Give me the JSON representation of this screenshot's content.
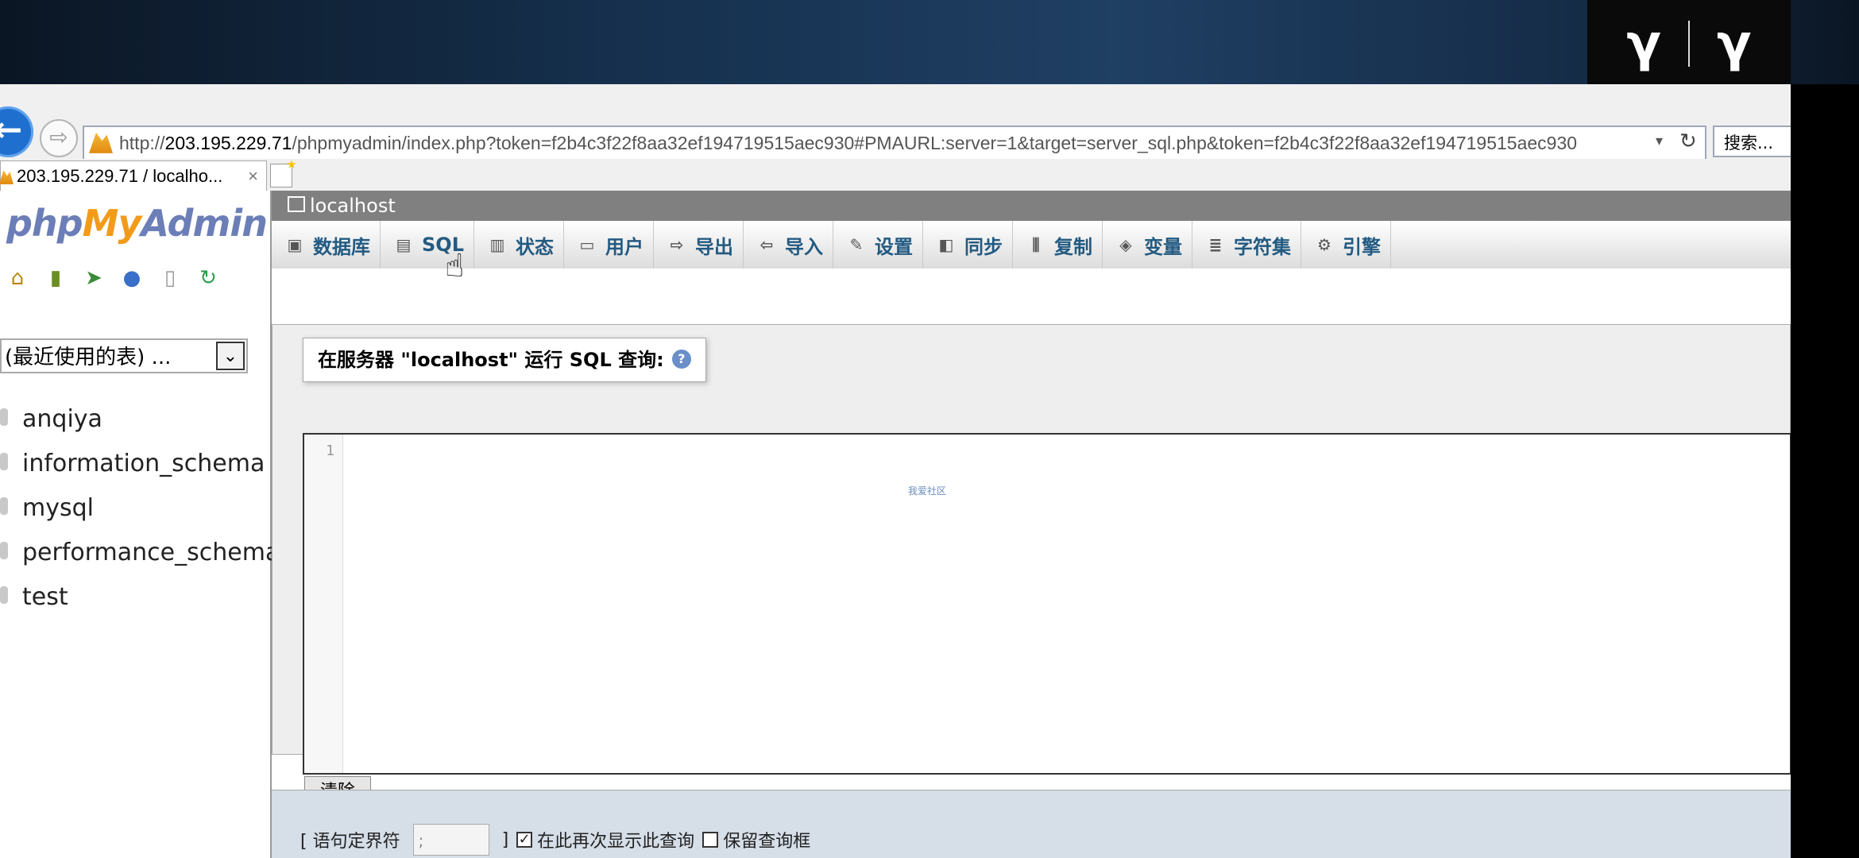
{
  "logo": {
    "left": "γ",
    "right": "γ"
  },
  "browser": {
    "url_prefix": "http://",
    "url_host": "203.195.229.71",
    "url_path": "/phpmyadmin/index.php?token=f2b4c3f22f8aa32ef194719515aec930#PMAURL:server=1&target=server_sql.php&token=f2b4c3f22f8aa32ef194719515aec930",
    "search_label": "搜索...",
    "tab_title": "203.195.229.71 / localho...",
    "tab_close": "×"
  },
  "sidebar": {
    "logo_php": "php",
    "logo_my": "My",
    "logo_admin": "Admin",
    "recent_tables": "(最近使用的表) ...",
    "databases": [
      "anqiya",
      "information_schema",
      "mysql",
      "performance_schema",
      "test"
    ]
  },
  "main": {
    "server": "localhost",
    "menu": [
      {
        "label": "数据库",
        "icon": "database-icon"
      },
      {
        "label": "SQL",
        "icon": "sql-icon"
      },
      {
        "label": "状态",
        "icon": "status-icon"
      },
      {
        "label": "用户",
        "icon": "users-icon"
      },
      {
        "label": "导出",
        "icon": "export-icon"
      },
      {
        "label": "导入",
        "icon": "import-icon"
      },
      {
        "label": "设置",
        "icon": "settings-icon"
      },
      {
        "label": "同步",
        "icon": "sync-icon"
      },
      {
        "label": "复制",
        "icon": "replication-icon"
      },
      {
        "label": "变量",
        "icon": "variables-icon"
      },
      {
        "label": "字符集",
        "icon": "charset-icon"
      },
      {
        "label": "引擎",
        "icon": "engines-icon"
      }
    ],
    "query_legend": "在服务器 \"localhost\" 运行 SQL 查询:",
    "line_number": "1",
    "watermark": "我爱社区",
    "clear_button": "清除",
    "delimiter_label": "[ 语句定界符",
    "delimiter_value": ";",
    "delimiter_close": "]",
    "show_query_label": "在此再次显示此查询",
    "show_query_checked": true,
    "retain_box_label": "保留查询框",
    "retain_box_checked": false
  }
}
